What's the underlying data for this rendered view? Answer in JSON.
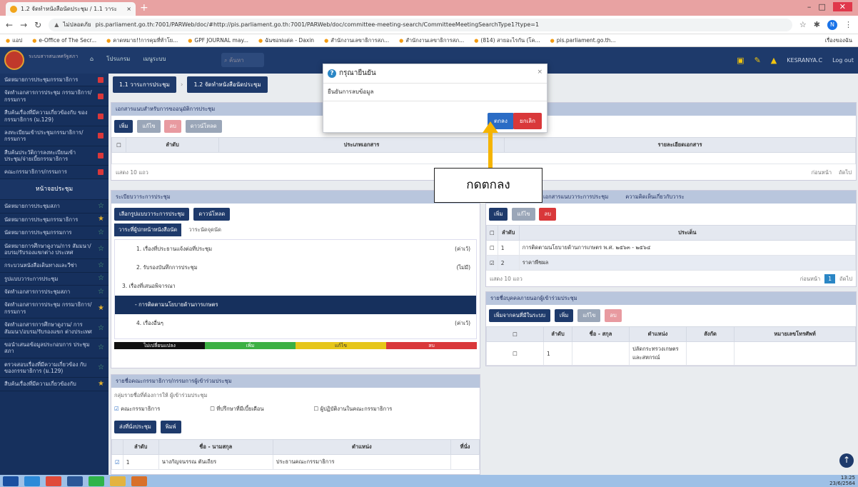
{
  "browser": {
    "tab_title": "1.2 จัดทำหนังสือนัดประชุม / 1.1 วาระ",
    "tab_close": "×",
    "new_tab": "+",
    "url_warning": "ไม่ปลอดภัย",
    "url": "pis.parliament.go.th:7001/PARWeb/doc/#http://pis.parliament.go.th:7001/PARWeb/doc/committee-meeting-search/CommitteeMeetingSearchType1?type=1",
    "profile_initial": "N",
    "bookmarks": [
      "แอป",
      "e-Office of The Secr...",
      "คาดหมาย!!การคุมที่ท้าโย...",
      "GPF JOURNAL may...",
      "ฉันซอฟแต่ค - Daxin",
      "สำนักงานเลขาธิการสภ...",
      "สำนักงานเลขาธิการสภ...",
      "(814) สายอะไรกัน (โค...",
      "pis.parliament.go.th..."
    ],
    "bookmarks_right": "เรื่องของฉัน"
  },
  "app": {
    "logo_text": "ระบบสารสนเทศรัฐสภา",
    "menu": [
      "โปรแกรม",
      "เมนูระบบ"
    ],
    "search_placeholder": "ค้นหา",
    "user": "KESRANYA.C",
    "logout": "Log out"
  },
  "sidebar": {
    "items": [
      {
        "label": "นัดหมายการประชุมกรรมาธิการ",
        "mark": "red"
      },
      {
        "label": "จัดทำเอกสารการประชุม กรรมาธิการ/กรรมการ",
        "mark": "red"
      },
      {
        "label": "สืบค้นเรื่องที่มีความเกี่ยวข้องกับ ของกรรมาธิการ (ม.129)",
        "mark": "red"
      },
      {
        "label": "ลงทะเบียนเข้าประชุมกรรมาธิการ/ กรรมการ",
        "mark": "red"
      },
      {
        "label": "สืบค้นประวัติการลงทะเบียนเข้า ประชุม/จ่ายเบี้ยกรรมาธิการ",
        "mark": "red"
      },
      {
        "label": "คณะกรรมาธิการ/กรรมการ",
        "mark": "red"
      },
      {
        "label": "หน้าจอประชุม",
        "mark": "head"
      },
      {
        "label": "นัดหมายการประชุมสภา",
        "mark": "star-off"
      },
      {
        "label": "นัดหมายการประชุมกรรมาธิการ",
        "mark": "star"
      },
      {
        "label": "นัดหมายการประชุมกรรมการ",
        "mark": "star-off"
      },
      {
        "label": "นัดหมายการศึกษาดูงาน/การ สัมมนา/อบรม/รับรองแขกต่าง ประเทศ",
        "mark": "star-off"
      },
      {
        "label": "กระบวนหนังสือเดินทางและวีซ่า",
        "mark": "star-off"
      },
      {
        "label": "รูปแบบวาระการประชุม",
        "mark": "star-off"
      },
      {
        "label": "จัดทำเอกสารการประชุมสภา",
        "mark": "star-off"
      },
      {
        "label": "จัดทำเอกสารการประชุม กรรมาธิการ/กรรมการ",
        "mark": "star"
      },
      {
        "label": "จัดทำเอกสารการศึกษาดูงาน/ การสัมมนา/อบรม/รับรองแขก ต่างประเทศ",
        "mark": "star-off"
      },
      {
        "label": "ขอนำเสนอข้อมูลประกอบการ ประชุมสภา",
        "mark": "star-off"
      },
      {
        "label": "ตรวจสอบเรื่องที่มีความเกี่ยวข้อง กับของกรรมาธิการ (ม.129)",
        "mark": "star-off"
      },
      {
        "label": "สืบค้นเรื่องที่มีความเกี่ยวข้องกับ",
        "mark": "star"
      }
    ]
  },
  "crumbs": [
    "1.1 วาระการประชุม",
    "1.2 จัดทำหนังสือนัดประชุม"
  ],
  "docs_panel": {
    "title": "เอกสารแนบสำหรับการขออนุมัติการประชุม",
    "buttons": [
      "เพิ่ม",
      "แก้ไข",
      "ลบ",
      "ดาวน์โหลด"
    ],
    "columns": [
      "ลำดับ",
      "ประเภทเอกสาร",
      "รายละเอียดเอกสาร"
    ],
    "pager_label": "แสดง 10 แถว",
    "prev": "ก่อนหน้า",
    "next": "ถัดไป"
  },
  "agenda_panel": {
    "title": "ระเบียบวาระการประชุม",
    "btn_select": "เลือกรูปแบบวาระการประชุม",
    "btn_download": "ดาวน์โหลด",
    "tabs": [
      "วาระที่ผู้ปกหน้าหนังสือนัด",
      "วาระนัดจุดนัด"
    ],
    "items": [
      {
        "label": "1. เรื่องที่ประธานแจ้งต่อที่ประชุม",
        "tag": "(ค่าเว้)"
      },
      {
        "label": "2. รับรองบันทึกการประชุม",
        "tag": "(ไม่มี)"
      },
      {
        "label": "3. เรื่องที่เสนอพิจารณา",
        "tag": ""
      },
      {
        "label": "- การติดตามนโยบายด้านการเกษตร",
        "tag": ""
      },
      {
        "label": "4. เรื่องอื่นๆ",
        "tag": "(ค่าเว้)"
      }
    ],
    "legend": [
      "ไม่เปลี่ยนแปลง",
      "เพิ่ม",
      "แก้ไข",
      "ลบ"
    ]
  },
  "right_panel": {
    "tabs": [
      "เอกสารแนบวาระการประชุม",
      "ความคิดเห็นเกี่ยวกับวาระ"
    ],
    "buttons": [
      "เพิ่ม",
      "แก้ไข",
      "ลบ"
    ],
    "columns": [
      "ลำดับ",
      "ประเด็น"
    ],
    "rows": [
      {
        "no": "1",
        "text": "การติดตามนโยบายด้านการเกษตร พ.ศ. ๒๕๖๓ - ๒๕๖๔"
      },
      {
        "no": "2",
        "text": "ราคาพืชผล"
      }
    ],
    "pager_label": "แสดง 10 แถว",
    "prev": "ก่อนหน้า",
    "page": "1",
    "next": "ถัดไป"
  },
  "attendees_panel": {
    "title": "รายชื่อบุคคลภายนอกผู้เข้าร่วมประชุม",
    "btn_import": "เพิ่มจากคนที่มีในระบบ",
    "buttons": [
      "เพิ่ม",
      "แก้ไข",
      "ลบ"
    ],
    "columns": [
      "ลำดับ",
      "ชื่อ - สกุล",
      "ตำแหน่ง",
      "สังกัด",
      "หมายเลขโทรศัพท์"
    ],
    "rows": [
      {
        "no": "1",
        "name": "",
        "position": "ปลัดกระทรวงเกษตร และสหกรณ์",
        "org": "",
        "phone": ""
      }
    ]
  },
  "committee_panel": {
    "title": "รายชื่อคณะกรรมาธิการ/กรรมการผู้เข้าร่วมประชุม",
    "sub": "กลุ่มรายชื่อที่ต้องการให้ ผู้เข้าร่วมประชุม",
    "checks": [
      "คณะกรรมาธิการ",
      "ที่ปรึกษาที่มีเบี้ยเดือน",
      "ผู้ปฏิบัติงานในคณะกรรมาธิการ"
    ],
    "btn_send": "ส่งที่นั่งประชุม",
    "btn_print": "พิมพ์",
    "columns": [
      "ลำดับ",
      "ชื่อ - นามสกุล",
      "ตำแหน่ง",
      "ที่นั่ง"
    ],
    "rows": [
      {
        "no": "1",
        "name": "นางกัญจนรรณ ตันเถียร",
        "position": "ประธานคณะกรรมาธิการ"
      }
    ]
  },
  "dialog": {
    "title": "กรุณายืนยัน",
    "message": "ยืนยันการลบข้อมูล",
    "ok": "ตกลง",
    "cancel": "ยกเลิก",
    "close": "×"
  },
  "annotation": {
    "callout": "กดตกลง",
    "color": "#f5b400"
  },
  "taskbar": {
    "time": "13:25",
    "date": "23/6/2564"
  }
}
